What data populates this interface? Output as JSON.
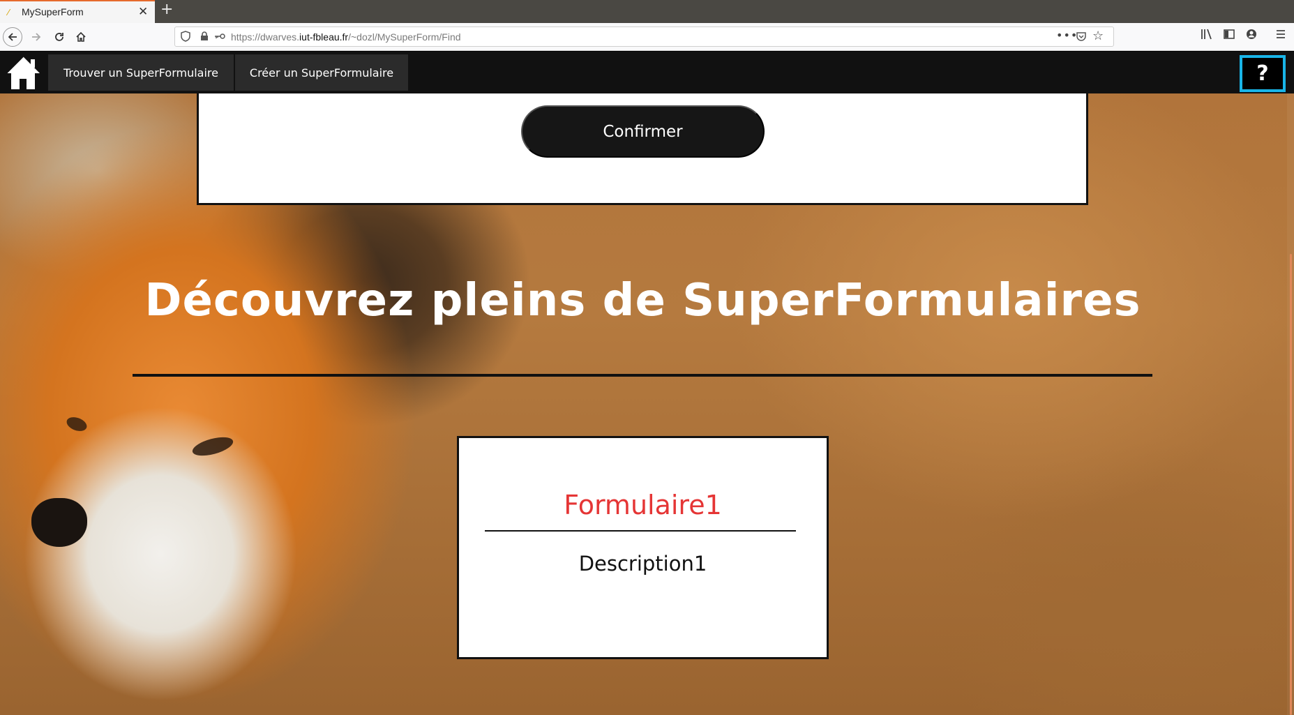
{
  "browser": {
    "tab_title": "MySuperForm",
    "tab_close": "✕",
    "new_tab": "+",
    "url_prefix": "https://dwarves.",
    "url_domain": "iut-fbleau.fr",
    "url_path": "/~dozl/MySuperForm/Find",
    "url_more": "•••",
    "bookmark_star": "☆"
  },
  "site_nav": {
    "home_icon": "house-icon",
    "find_label": "Trouver un SuperFormulaire",
    "create_label": "Créer un SuperFormulaire",
    "help_label": "?",
    "help_border_color": "#19b5e8"
  },
  "search_panel": {
    "confirm_label": "Confirmer"
  },
  "main": {
    "headline": "Découvrez pleins de SuperFormulaires"
  },
  "forms": [
    {
      "title": "Formulaire1",
      "description": "Description1",
      "title_color": "#e53535"
    }
  ]
}
